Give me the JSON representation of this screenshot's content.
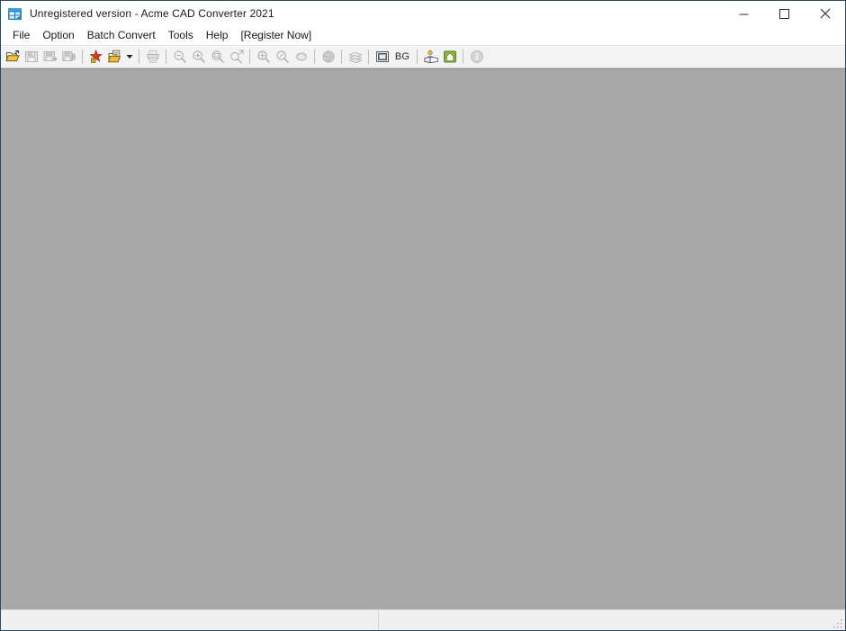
{
  "window": {
    "title": "Unregistered version - Acme CAD Converter 2021",
    "icon": "app-cad-icon",
    "controls": {
      "minimize": "—",
      "maximize": "☐",
      "close": "✕",
      "minimize_name": "minimize-button",
      "maximize_name": "maximize-button",
      "close_name": "close-button"
    }
  },
  "menubar": {
    "items": [
      {
        "label": "File",
        "name": "menu-file"
      },
      {
        "label": "Option",
        "name": "menu-option"
      },
      {
        "label": "Batch Convert",
        "name": "menu-batch-convert"
      },
      {
        "label": "Tools",
        "name": "menu-tools"
      },
      {
        "label": "Help",
        "name": "menu-help"
      },
      {
        "label": "[Register Now]",
        "name": "menu-register-now"
      }
    ]
  },
  "toolbar": {
    "buttons": [
      {
        "icon": "open-file-icon",
        "enabled": true,
        "label": "Open"
      },
      {
        "icon": "save-icon",
        "enabled": false,
        "label": "Save"
      },
      {
        "icon": "save-as-icon",
        "enabled": false,
        "label": "Save As"
      },
      {
        "icon": "save-all-icon",
        "enabled": false,
        "label": "Save All"
      },
      {
        "separator": true
      },
      {
        "icon": "export-pdf-icon",
        "enabled": true,
        "label": "Export to PDF"
      },
      {
        "icon": "batch-convert-icon",
        "enabled": true,
        "label": "Batch Convert",
        "dropdown": true
      },
      {
        "separator": true
      },
      {
        "icon": "print-icon",
        "enabled": false,
        "label": "Print"
      },
      {
        "separator": true
      },
      {
        "icon": "zoom-out-icon",
        "enabled": false,
        "label": "Zoom Out"
      },
      {
        "icon": "zoom-in-icon",
        "enabled": false,
        "label": "Zoom In"
      },
      {
        "icon": "zoom-window-icon",
        "enabled": false,
        "label": "Zoom Window"
      },
      {
        "icon": "zoom-extents-icon",
        "enabled": false,
        "label": "Zoom Extents"
      },
      {
        "separator": true
      },
      {
        "icon": "zoom-previous-icon",
        "enabled": false,
        "label": "Zoom Previous"
      },
      {
        "icon": "zoom-scale-icon",
        "enabled": false,
        "label": "Zoom Scale"
      },
      {
        "icon": "pan-icon",
        "enabled": false,
        "label": "Pan"
      },
      {
        "separator": true
      },
      {
        "icon": "world-icon",
        "enabled": false,
        "label": "Views"
      },
      {
        "separator": true
      },
      {
        "icon": "layers-icon",
        "enabled": false,
        "label": "Layers"
      },
      {
        "separator": true
      },
      {
        "icon": "viewport-icon",
        "enabled": true,
        "label": "Viewport"
      },
      {
        "icon": "bg-color-icon",
        "enabled": true,
        "label": "BG",
        "text": "BG"
      },
      {
        "separator": true
      },
      {
        "icon": "help-book-icon",
        "enabled": true,
        "label": "Help"
      },
      {
        "icon": "home-icon",
        "enabled": true,
        "label": "Home Page"
      },
      {
        "separator": true
      },
      {
        "icon": "info-icon",
        "enabled": false,
        "label": "About"
      }
    ],
    "bg_text": "BG"
  },
  "canvas": {
    "name": "mdi-client-area",
    "background_color": "#a8a8a8",
    "content": ""
  },
  "statusbar": {
    "main_text": "",
    "mid_text": "",
    "grip": "resize-grip"
  },
  "colors": {
    "window_border": "#2e4a5c",
    "titlebar": "#ffffff",
    "toolbar": "#f3f3f3",
    "canvas": "#a8a8a8",
    "statusbar": "#f0f0f0",
    "accent_yellow": "#e8b33a",
    "accent_red": "#d83a20",
    "accent_green": "#4e9c2e"
  }
}
